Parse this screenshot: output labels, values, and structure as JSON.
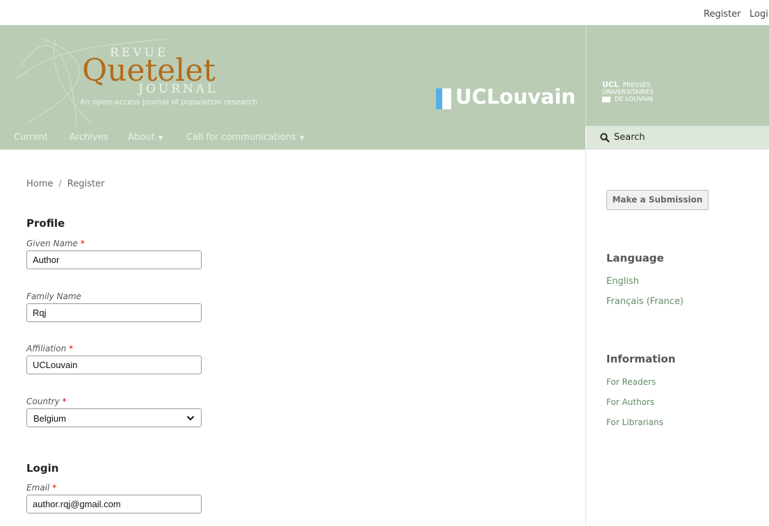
{
  "topbar": {
    "register": "Register",
    "login": "Login"
  },
  "header": {
    "logo_revue": "REVUE",
    "logo_quetelet": "Quetelet",
    "logo_journal": "JOURNAL",
    "tagline": "An open-access journal of population research",
    "uclouvain": "UCLouvain",
    "press_line1": "UCL",
    "press_line1b": "PRESSES",
    "press_line2": "UNIVERSITAIRES",
    "press_line3": "DE LOUVAIN"
  },
  "nav": {
    "current": "Current",
    "archives": "Archives",
    "about": "About",
    "call": "Call for communications",
    "search": "Search"
  },
  "breadcrumb": {
    "home": "Home",
    "separator": "/",
    "current": "Register"
  },
  "profile": {
    "title": "Profile",
    "given_name_label": "Given Name",
    "given_name_value": "Author",
    "family_name_label": "Family Name",
    "family_name_value": "Rqj",
    "affiliation_label": "Affiliation",
    "affiliation_value": "UCLouvain",
    "country_label": "Country",
    "country_value": "Belgium",
    "required_mark": "*"
  },
  "login": {
    "title": "Login",
    "email_label": "Email",
    "email_value": "author.rqj@gmail.com"
  },
  "sidebar": {
    "submit": "Make a Submission",
    "language_title": "Language",
    "lang_en": "English",
    "lang_fr": "Français (France)",
    "info_title": "Information",
    "info_readers": "For Readers",
    "info_authors": "For Authors",
    "info_librarians": "For Librarians"
  },
  "colors": {
    "header_green": "#bacdb4",
    "logo_orange": "#b36b1c",
    "link_green": "#5f8c66",
    "required_red": "#dd0000"
  }
}
